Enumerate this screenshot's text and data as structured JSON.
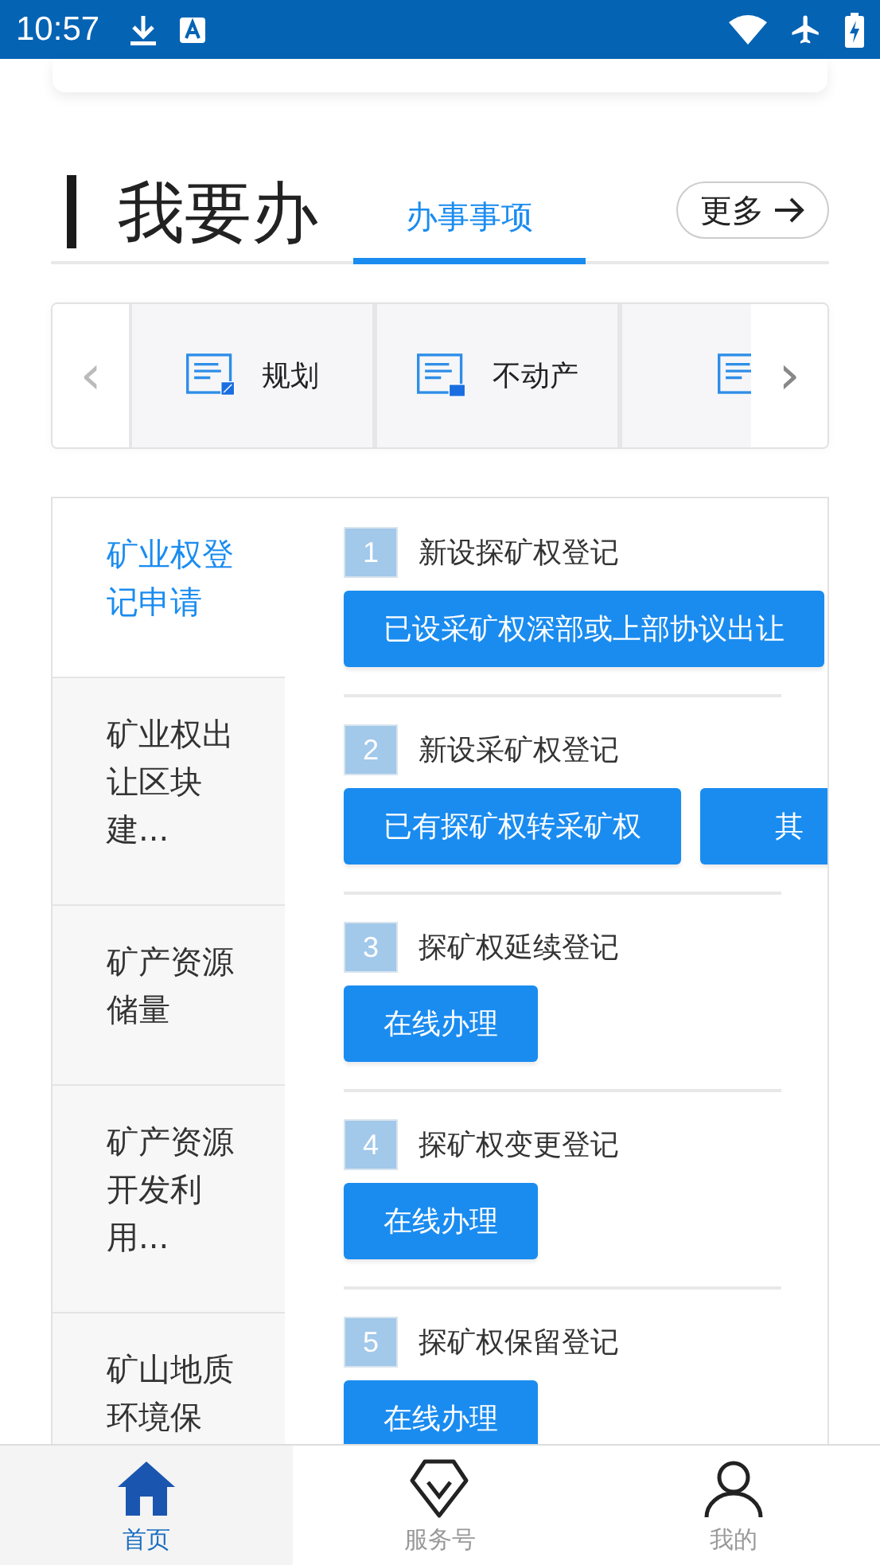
{
  "status_bar": {
    "time": "10:57"
  },
  "header": {
    "title": "我要办",
    "tab": {
      "label": "办事事项",
      "selected": true
    },
    "more_button": "更多"
  },
  "categories": {
    "prev": "‹",
    "next": "›",
    "items": [
      {
        "label": "规划",
        "kind": "map"
      },
      {
        "label": "不动产",
        "kind": "building"
      },
      {
        "kind": "house"
      }
    ]
  },
  "menu": [
    {
      "label": "矿业权登记申请",
      "selected": true
    },
    {
      "label": "矿业权出让区块建...",
      "selected": false
    },
    {
      "label": "矿产资源储量",
      "selected": false
    },
    {
      "label": "矿产资源开发利用...",
      "selected": false
    },
    {
      "label": "矿山地质环境保",
      "selected": false
    }
  ],
  "services": [
    {
      "number": "1",
      "title": "新设探矿权登记",
      "buttons": [
        "已设采矿权深部或上部协议出让"
      ]
    },
    {
      "number": "2",
      "title": "新设采矿权登记",
      "buttons": [
        "已有探矿权转采矿权",
        "其"
      ]
    },
    {
      "number": "3",
      "title": "探矿权延续登记",
      "buttons": [
        "在线办理"
      ]
    },
    {
      "number": "4",
      "title": "探矿权变更登记",
      "buttons": [
        "在线办理"
      ]
    },
    {
      "number": "5",
      "title": "探矿权保留登记",
      "buttons": [
        "在线办理"
      ]
    }
  ],
  "bottom_nav": [
    {
      "label": "首页",
      "kind": "home",
      "selected": true
    },
    {
      "label": "服务号",
      "kind": "service",
      "selected": false
    },
    {
      "label": "我的",
      "kind": "profile",
      "selected": false
    }
  ]
}
